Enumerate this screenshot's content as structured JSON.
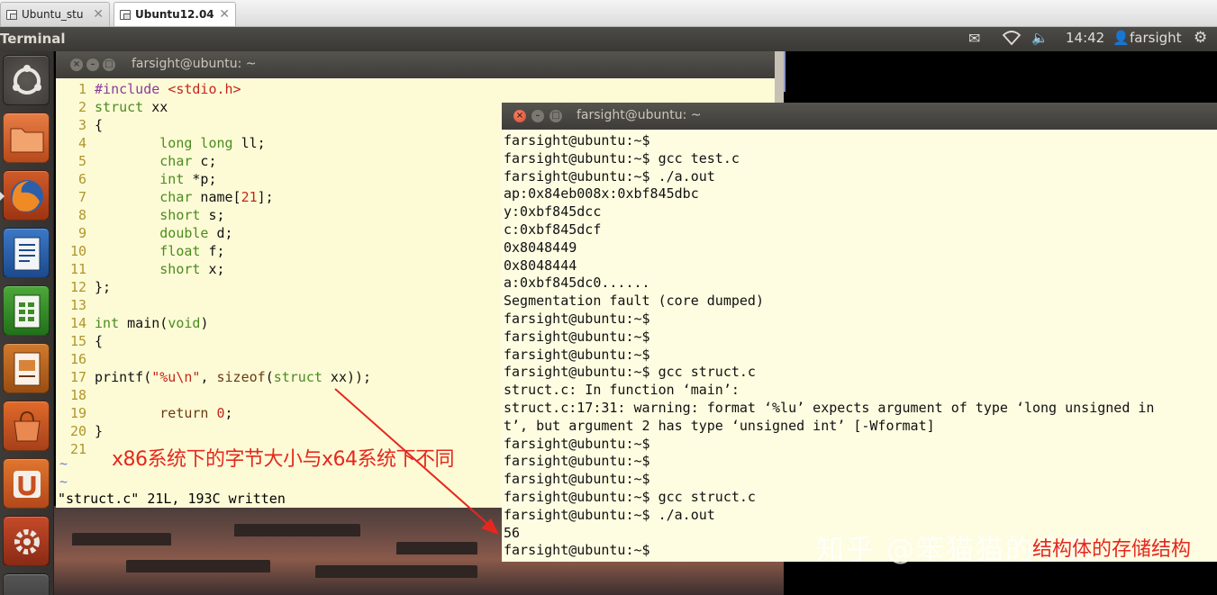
{
  "vm_tabs": [
    {
      "label": "Ubuntu_stu",
      "active": false
    },
    {
      "label": "Ubuntu12.04",
      "active": true
    }
  ],
  "panel": {
    "app_title": "Terminal",
    "time": "14:42",
    "user": "farsight"
  },
  "vim_window": {
    "title": "farsight@ubuntu: ~",
    "lines": [
      {
        "n": "1",
        "t": "#include <stdio.h>"
      },
      {
        "n": "2",
        "t": "struct xx"
      },
      {
        "n": "3",
        "t": "{"
      },
      {
        "n": "4",
        "t": "        long long ll;"
      },
      {
        "n": "5",
        "t": "        char c;"
      },
      {
        "n": "6",
        "t": "        int *p;"
      },
      {
        "n": "7",
        "t": "        char name[21];"
      },
      {
        "n": "8",
        "t": "        short s;"
      },
      {
        "n": "9",
        "t": "        double d;"
      },
      {
        "n": "10",
        "t": "        float f;"
      },
      {
        "n": "11",
        "t": "        short x;"
      },
      {
        "n": "12",
        "t": "};"
      },
      {
        "n": "13",
        "t": ""
      },
      {
        "n": "14",
        "t": "int main(void)"
      },
      {
        "n": "15",
        "t": "{"
      },
      {
        "n": "16",
        "t": ""
      },
      {
        "n": "17",
        "t": "printf(\"%u\\n\", sizeof(struct xx));"
      },
      {
        "n": "18",
        "t": ""
      },
      {
        "n": "19",
        "t": "        return 0;"
      },
      {
        "n": "20",
        "t": "}"
      },
      {
        "n": "21",
        "t": ""
      }
    ],
    "tildes": [
      "~",
      "~"
    ],
    "status": "\"struct.c\" 21L, 193C written"
  },
  "terminal_window": {
    "title": "farsight@ubuntu: ~",
    "lines": [
      "farsight@ubuntu:~$",
      "farsight@ubuntu:~$ gcc test.c",
      "farsight@ubuntu:~$ ./a.out",
      "ap:0x84eb008x:0xbf845dbc",
      "y:0xbf845dcc",
      "c:0xbf845dcf",
      "0x8048449",
      "0x8048444",
      "a:0xbf845dc0......",
      "Segmentation fault (core dumped)",
      "farsight@ubuntu:~$",
      "farsight@ubuntu:~$",
      "farsight@ubuntu:~$",
      "farsight@ubuntu:~$ gcc struct.c",
      "struct.c: In function ‘main’:",
      "struct.c:17:31: warning: format ‘%lu’ expects argument of type ‘long unsigned in",
      "t’, but argument 2 has type ‘unsigned int’ [-Wformat]",
      "farsight@ubuntu:~$",
      "farsight@ubuntu:~$",
      "farsight@ubuntu:~$",
      "farsight@ubuntu:~$ gcc struct.c",
      "farsight@ubuntu:~$ ./a.out",
      "56",
      "farsight@ubuntu:~$"
    ]
  },
  "annotation": "x86系统下的字节大小与x64系统下不同",
  "watermark": "知乎 @笨猫猫的小窝",
  "caption_partial": "结构体的存储结构",
  "icons": [
    "ubuntu-logo-icon",
    "home-folder-icon",
    "firefox-icon",
    "writer-icon",
    "calc-icon",
    "impress-icon",
    "software-center-icon",
    "ubuntu-one-icon",
    "system-settings-icon"
  ],
  "colors": {
    "annotation_red": "#e5281e",
    "panel_bg": "#3c3b37",
    "vim_bg": "#fdfbd6"
  }
}
